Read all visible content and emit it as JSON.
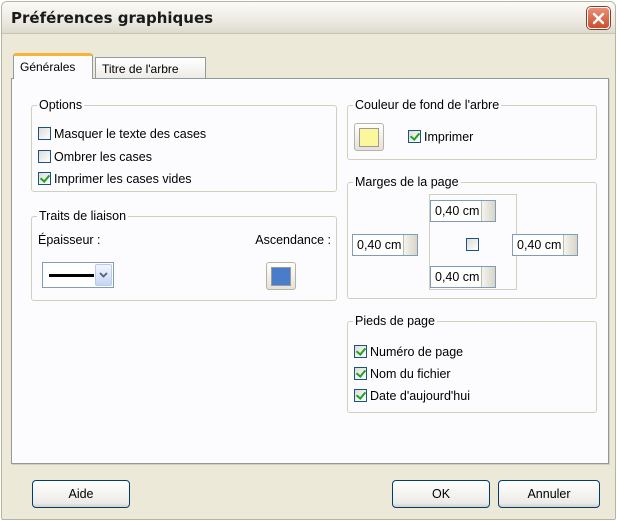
{
  "window": {
    "title": "Préférences graphiques"
  },
  "tabs": [
    {
      "label": "Générales",
      "active": true
    },
    {
      "label": "Titre de l'arbre",
      "active": false
    }
  ],
  "options": {
    "legend": "Options",
    "items": [
      {
        "label": "Masquer le texte des cases",
        "checked": false
      },
      {
        "label": "Ombrer les cases",
        "checked": false
      },
      {
        "label": "Imprimer les cases vides",
        "checked": true
      }
    ]
  },
  "traits": {
    "legend": "Traits de liaison",
    "epaisseur_label": "Épaisseur :",
    "ascendance_label": "Ascendance :",
    "ascendance_color": "#4a7dc9"
  },
  "couleur_fond": {
    "legend": "Couleur de fond de l'arbre",
    "color": "#fbf79a",
    "imprimer_label": "Imprimer",
    "imprimer_checked": true
  },
  "marges": {
    "legend": "Marges de la page",
    "top": "0,40 cm",
    "left": "0,40 cm",
    "right": "0,40 cm",
    "bottom": "0,40 cm",
    "center_checked": false
  },
  "pieds": {
    "legend": "Pieds de page",
    "items": [
      {
        "label": "Numéro de page",
        "checked": true
      },
      {
        "label": "Nom du fichier",
        "checked": true
      },
      {
        "label": "Date d'aujourd'hui",
        "checked": true
      }
    ]
  },
  "buttons": {
    "help": "Aide",
    "ok": "OK",
    "cancel": "Annuler"
  },
  "colors": {
    "accent_tab": "#f7b23b",
    "close_red": "#c94e2e",
    "check_green": "#21a121"
  }
}
